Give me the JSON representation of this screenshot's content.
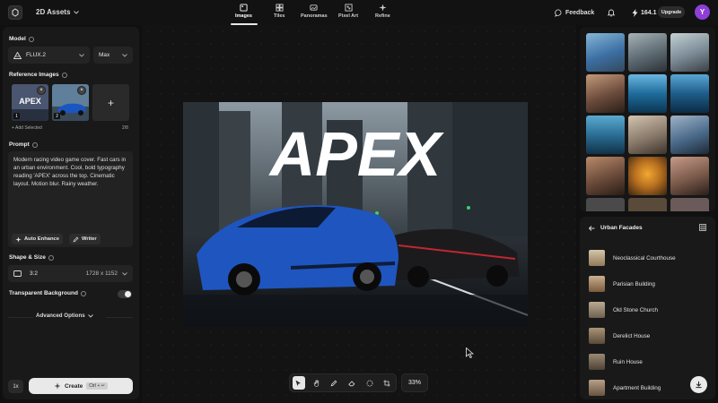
{
  "topbar": {
    "project_title": "2D Assets",
    "tabs": [
      {
        "label": "Images",
        "icon": "image-icon"
      },
      {
        "label": "Tiles",
        "icon": "tiles-icon"
      },
      {
        "label": "Panoramas",
        "icon": "panorama-icon"
      },
      {
        "label": "Pixel Art",
        "icon": "pixel-icon"
      },
      {
        "label": "Refine",
        "icon": "sparkle-icon"
      }
    ],
    "feedback_label": "Feedback",
    "credits": "164.1",
    "upgrade_label": "Upgrade",
    "avatar_letter": "Y",
    "colors": {
      "avatar": "#8d3fd6"
    }
  },
  "left": {
    "model_label": "Model",
    "model_value": "FLUX.2",
    "quality_value": "Max",
    "reference_label": "Reference Images",
    "ref_thumbs": [
      {
        "num": "1",
        "text": "APEX"
      },
      {
        "num": "2"
      }
    ],
    "add_selected_label": "+ Add Selected",
    "ref_count": "2/8",
    "prompt_label": "Prompt",
    "prompt_text": "Modern racing video game cover. Fast cars in an urban environment. Cool, bold typography reading 'APEX' across the top. Cinematic layout. Motion blur. Rainy weather.",
    "auto_enhance_label": "Auto Enhance",
    "writer_label": "Writer",
    "shape_label": "Shape & Size",
    "ratio_value": "3:2",
    "dimensions": "1728 x 1152",
    "transparent_label": "Transparent Background",
    "advanced_label": "Advanced Options",
    "batch_value": "1x",
    "create_label": "Create",
    "create_shortcut": "Ctrl + ↵"
  },
  "canvas": {
    "artwork_title": "APEX",
    "zoom": "33%",
    "tools": [
      "select-icon",
      "hand-icon",
      "pen-icon",
      "eraser-icon",
      "lasso-icon",
      "crop-icon"
    ]
  },
  "right": {
    "collection_title": "Urban Facades",
    "assets": [
      {
        "name": "Neoclassical Courthouse"
      },
      {
        "name": "Parisian Building"
      },
      {
        "name": "Old Stone Church"
      },
      {
        "name": "Derelict House"
      },
      {
        "name": "Ruin House"
      },
      {
        "name": "Apartment Building"
      }
    ],
    "gallery_colors": [
      [
        "#3c6fa3",
        "#5d6a72",
        "#7a8a95"
      ],
      [
        "#6b4b3c",
        "#1e6c9b",
        "#1e5d8a"
      ],
      [
        "#2b6f95",
        "#8a7a6b",
        "#4a6a8a"
      ],
      [
        "#6a4a3a",
        "#b87020",
        "#7a5a4a"
      ],
      [
        "#4a4a4a",
        "#5a4a3a",
        "#6a5a5a"
      ]
    ]
  }
}
